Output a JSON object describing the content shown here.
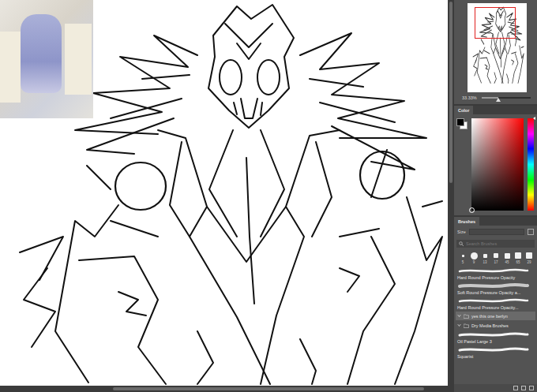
{
  "canvas": {
    "reference_photo": true
  },
  "navigator": {
    "zoom": "33.33%",
    "level": 0.35
  },
  "color_panel": {
    "tab": "Color",
    "hue_level": 0.0
  },
  "brushes_panel": {
    "tab": "Brushes",
    "size_label": "Size",
    "search": {
      "placeholder": "Search Brushes"
    },
    "tips": [
      {
        "label": "5"
      },
      {
        "label": "9"
      },
      {
        "label": "13"
      },
      {
        "label": "17"
      },
      {
        "label": "45"
      },
      {
        "label": "65"
      },
      {
        "label": "29"
      }
    ],
    "presets": [
      {
        "label": "Hard Round Pressure Opacity",
        "kind": "brush",
        "selected": false
      },
      {
        "label": "Soft Round Pressure Opacity a...",
        "kind": "brush",
        "selected": false
      },
      {
        "label": "Hard Round Pressure Opacity...",
        "kind": "brush",
        "selected": false
      },
      {
        "label": "yes this one berlyn",
        "kind": "folder",
        "selected": true,
        "expanded": true
      },
      {
        "label": "Dry Media Brushes",
        "kind": "folder",
        "selected": false,
        "expanded": true
      },
      {
        "label": "Oil Pastel Large 3",
        "kind": "brush",
        "selected": false
      },
      {
        "label": "Squarist",
        "kind": "brush",
        "selected": false
      }
    ]
  }
}
